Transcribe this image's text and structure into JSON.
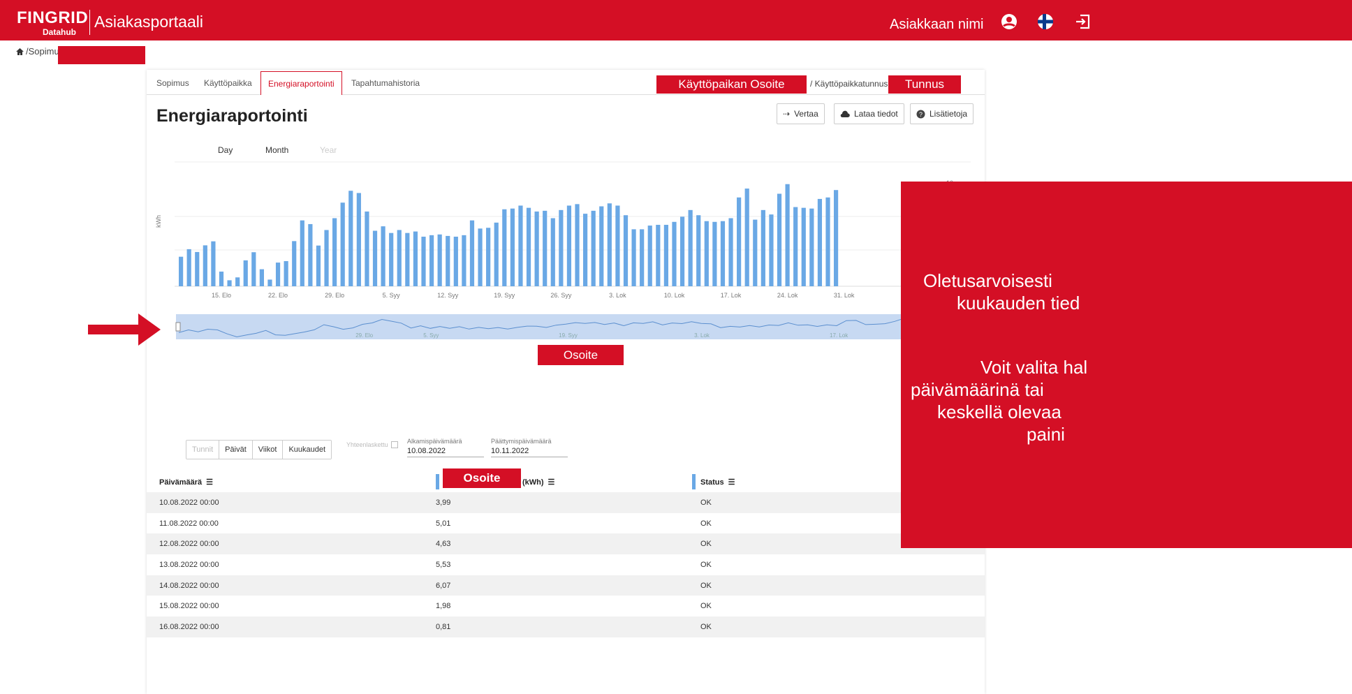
{
  "header": {
    "logo_main": "FINGRID",
    "logo_sub": "Datahub",
    "app_title": "Asiakasportaali",
    "user_name": "Asiakkaan nimi"
  },
  "breadcrumb": {
    "text": "/Sopimu"
  },
  "tabs": [
    {
      "label": "Sopimus"
    },
    {
      "label": "Käyttöpaikka"
    },
    {
      "label": "Energiaraportointi"
    },
    {
      "label": "Tapahtumahistoria"
    }
  ],
  "tab_info": {
    "address_label": "Käyttöpaikan Osoite",
    "separator": "/ Käyttöpaikkatunnus",
    "id_label": "Tunnus"
  },
  "page": {
    "title": "Energiaraportointi",
    "compare_label": "Vertaa",
    "download_label": "Lataa tiedot",
    "info_label": "Lisätietoja"
  },
  "range_tabs": {
    "day": "Day",
    "month": "Month",
    "year": "Year"
  },
  "chart_data": {
    "type": "bar",
    "ylabel": "kWh",
    "ytick_top": "10",
    "x_ticks": [
      "15. Elo",
      "22. Elo",
      "29. Elo",
      "5. Syy",
      "12. Syy",
      "19. Syy",
      "26. Syy",
      "3. Lok",
      "10. Lok",
      "17. Lok",
      "24. Lok",
      "31. Lok"
    ],
    "navigator_labels": [
      "29. Elo",
      "5. Syy",
      "19. Syy",
      "3. Lok",
      "17. Lok",
      "31. Lok"
    ],
    "start_day": "10.08.2022",
    "values": [
      3.99,
      5.01,
      4.63,
      5.53,
      6.07,
      1.98,
      0.81,
      1.2,
      3.5,
      4.6,
      2.3,
      0.9,
      3.2,
      3.4,
      6.1,
      8.9,
      8.4,
      5.5,
      7.6,
      9.2,
      11.3,
      12.9,
      12.6,
      10.1,
      7.5,
      8.1,
      7.2,
      7.6,
      7.2,
      7.4,
      6.7,
      6.9,
      7.0,
      6.8,
      6.7,
      6.9,
      8.9,
      7.8,
      7.9,
      8.6,
      10.4,
      10.5,
      10.9,
      10.6,
      10.1,
      10.2,
      9.2,
      10.3,
      10.9,
      11.1,
      9.8,
      10.2,
      10.8,
      11.2,
      10.9,
      9.6,
      7.7,
      7.7,
      8.2,
      8.3,
      8.3,
      8.7,
      9.4,
      10.3,
      9.6,
      8.8,
      8.7,
      8.8,
      9.2,
      12.0,
      13.2,
      9.0,
      10.3,
      9.7,
      12.5,
      13.8,
      10.7,
      10.6,
      10.5,
      11.8,
      12.0,
      13.0
    ]
  },
  "markers": {
    "dot_label": "Osoite",
    "value_header_redact": "Osoite"
  },
  "filters": {
    "segments": [
      "Tunnit",
      "Päivät",
      "Viikot",
      "Kuukaudet"
    ],
    "summary_label": "Yhteenlaskettu",
    "start_label": "Alkamispäivämäärä",
    "start_value": "10.08.2022",
    "end_label": "Päättymispäivämäärä",
    "end_value": "10.11.2022"
  },
  "table": {
    "col_date": "Päivämäärä",
    "col_value_suffix": "(kWh)",
    "col_status": "Status",
    "rows": [
      {
        "date": "10.08.2022 00:00",
        "value": "3,99",
        "status": "OK"
      },
      {
        "date": "11.08.2022 00:00",
        "value": "5,01",
        "status": "OK"
      },
      {
        "date": "12.08.2022 00:00",
        "value": "4,63",
        "status": "OK"
      },
      {
        "date": "13.08.2022 00:00",
        "value": "5,53",
        "status": "OK"
      },
      {
        "date": "14.08.2022 00:00",
        "value": "6,07",
        "status": "OK"
      },
      {
        "date": "15.08.2022 00:00",
        "value": "1,98",
        "status": "OK"
      },
      {
        "date": "16.08.2022 00:00",
        "value": "0,81",
        "status": "OK"
      }
    ]
  },
  "overlay": {
    "lines": [
      "Oletusarvoisesti",
      "kuukauden tied",
      "Voit valita hal",
      "päivämäärinä tai",
      "keskellä olevaa",
      "paini"
    ]
  },
  "colors": {
    "brand_red": "#d40f25",
    "bar_blue": "#6aa8e5",
    "navigator_bg": "#c7d9f2"
  }
}
